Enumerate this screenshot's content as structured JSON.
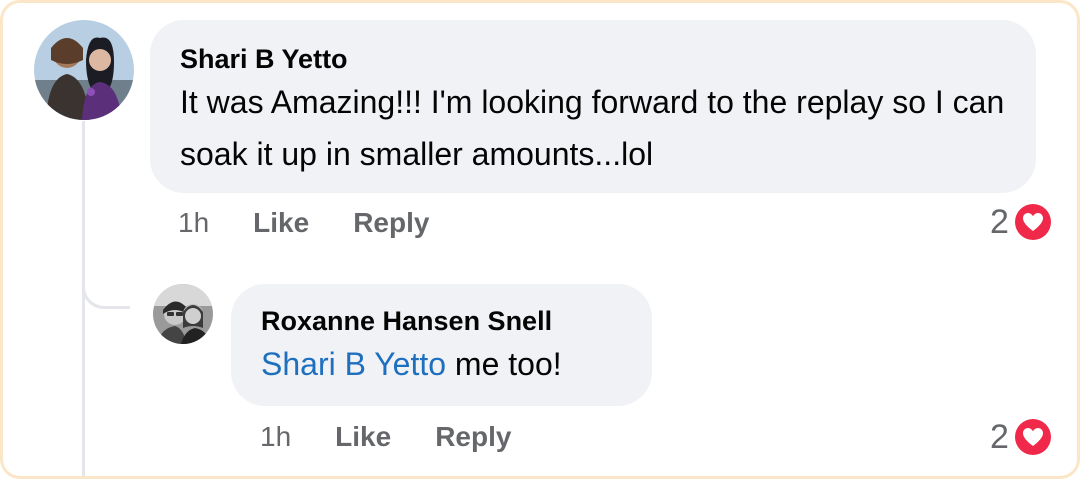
{
  "comments": [
    {
      "author": "Shari B Yetto",
      "text": "It was Amazing!!! I'm looking forward to the replay so I can soak it up in smaller amounts...lol",
      "time": "1h",
      "like_label": "Like",
      "reply_label": "Reply",
      "reaction_count": "2",
      "reaction_icon": "heart-icon"
    },
    {
      "author": "Roxanne Hansen Snell",
      "mention": "Shari B Yetto",
      "text": " me too!",
      "time": "1h",
      "like_label": "Like",
      "reply_label": "Reply",
      "reaction_count": "2",
      "reaction_icon": "heart-icon"
    }
  ],
  "colors": {
    "bubble": "#f0f2f5",
    "mention": "#1f6fbf",
    "meta": "#65676b",
    "heart": "#f0284a",
    "frame": "#fbe6c7"
  }
}
